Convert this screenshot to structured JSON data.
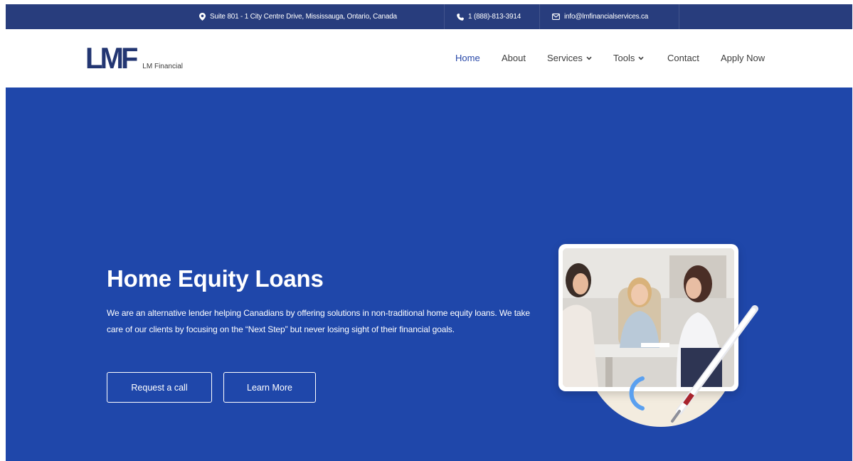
{
  "topbar": {
    "address": "Suite 801 - 1 City Centre Drive, Mississauga, Ontario, Canada",
    "phone": "1 (888)-813-3914",
    "email": "info@lmfinancialservices.ca",
    "bg_color": "#283d7d",
    "icons": [
      "location-pin-icon",
      "phone-icon",
      "envelope-icon"
    ]
  },
  "logo": {
    "mark": "LMF",
    "text": "LM Financial",
    "color": "#233672"
  },
  "nav": {
    "items": [
      {
        "label": "Home",
        "active": true,
        "dropdown": false
      },
      {
        "label": "About",
        "active": false,
        "dropdown": false
      },
      {
        "label": "Services",
        "active": false,
        "dropdown": true
      },
      {
        "label": "Tools",
        "active": false,
        "dropdown": true
      },
      {
        "label": "Contact",
        "active": false,
        "dropdown": false
      },
      {
        "label": "Apply Now",
        "active": false,
        "dropdown": false
      }
    ],
    "active_color": "#2747a8"
  },
  "hero": {
    "title": "Home Equity Loans",
    "description": "We are an alternative lender helping Canadians by offering solutions in non-traditional home equity loans. We take care of our clients by focusing on the “Next Step” but never losing sight of their financial goals.",
    "buttons": {
      "request_call": "Request a call",
      "learn_more": "Learn More"
    },
    "bg_color": "#1f47aa"
  }
}
